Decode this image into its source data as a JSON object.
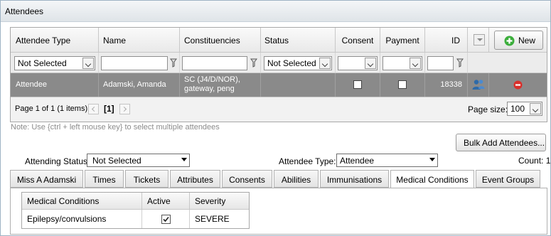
{
  "panel": {
    "title": "Attendees"
  },
  "grid": {
    "columns": [
      "Attendee Type",
      "Name",
      "Constituencies",
      "Status",
      "Consent",
      "Payment",
      "ID"
    ],
    "new_button": "New",
    "filters": {
      "attendee_type": "Not Selected",
      "status": "Not Selected"
    },
    "row": {
      "attendee_type": "Attendee",
      "name": "Adamski, Amanda",
      "constituencies": "SC (J4/D/NOR), gateway, peng",
      "status": "",
      "consent_checked": false,
      "payment_checked": false,
      "id": "18338"
    },
    "pager": {
      "summary": "Page 1 of 1 (1 items)",
      "current_page": "[1]",
      "page_size_label": "Page size:",
      "page_size": "100"
    }
  },
  "note": "Note: Use {ctrl + left mouse key} to select multiple attendees",
  "bulk_add_button": "Bulk Add Attendees...",
  "attending_status": {
    "label": "Attending Status:",
    "value": "Not Selected"
  },
  "attendee_type": {
    "label": "Attendee Type:",
    "value": "Attendee"
  },
  "count": "Count: 1",
  "tabs": [
    "Miss A Adamski",
    "Times",
    "Tickets",
    "Attributes",
    "Consents",
    "Abilities",
    "Immunisations",
    "Medical Conditions",
    "Event Groups"
  ],
  "active_tab": "Medical Conditions",
  "medical": {
    "headers": [
      "Medical Conditions",
      "Active",
      "Severity"
    ],
    "rows": [
      {
        "condition": "Epilepsy/convulsions",
        "active": true,
        "severity": "SEVERE"
      }
    ]
  },
  "colors": {
    "selected_row": "#8a8a8a",
    "new_icon": "#3cae3c",
    "remove_icon": "#d9302b",
    "person_icon": "#3a78b8"
  }
}
